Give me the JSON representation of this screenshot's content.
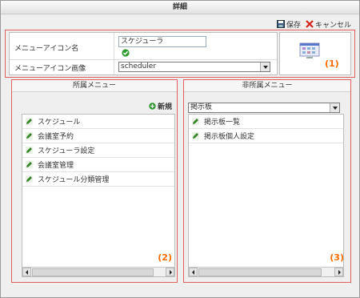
{
  "window": {
    "title": "詳細"
  },
  "toolbar": {
    "save_label": "保存",
    "cancel_label": "キャンセル"
  },
  "form": {
    "name_label": "メニューアイコン名",
    "name_value": "スケジューラ",
    "image_label": "メニューアイコン画像",
    "image_value": "scheduler",
    "marker": "(1)"
  },
  "assigned": {
    "header": "所属メニュー",
    "new_label": "新規",
    "items": [
      "スケジュール",
      "会議室予約",
      "スケジューラ設定",
      "会議室管理",
      "スケジュール分類管理"
    ],
    "marker": "(2)"
  },
  "unassigned": {
    "header": "非所属メニュー",
    "filter_value": "掲示板",
    "items": [
      "掲示板一覧",
      "掲示板個人設定"
    ],
    "marker": "(3)"
  },
  "colors": {
    "accent_marker": "#ff6a00",
    "highlight_border": "#e06060"
  }
}
